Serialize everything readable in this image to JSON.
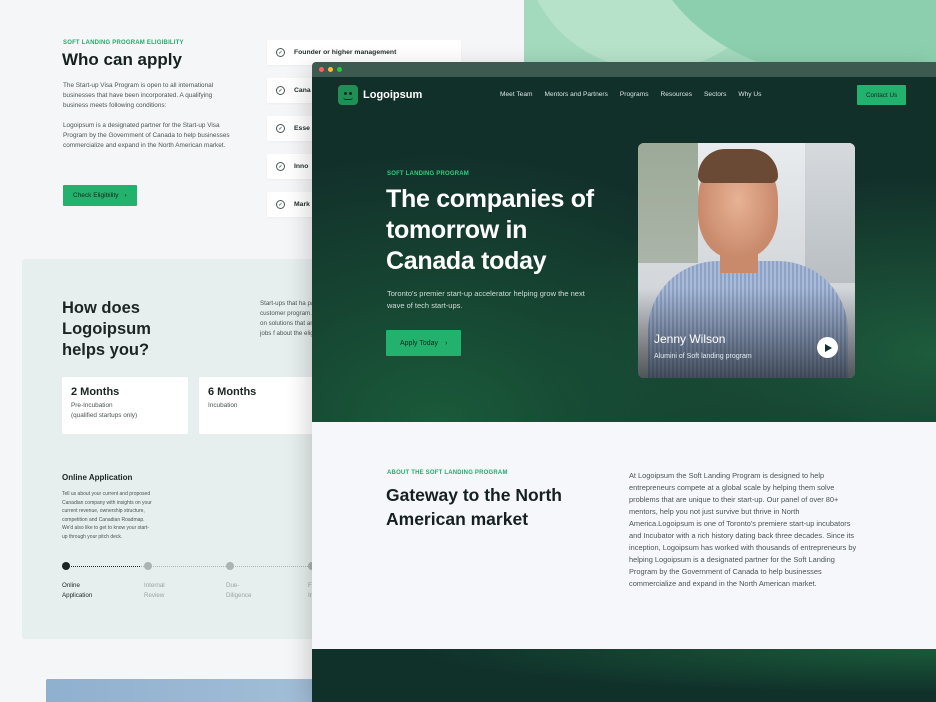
{
  "colors": {
    "accent": "#23b26d",
    "dark": "#12302a",
    "mint": "#a3d9bd"
  },
  "back": {
    "who": {
      "eyebrow": "SOFT LANDING PROGRAM ELIGIBILITY",
      "title": "Who can apply",
      "p1": "The Start-up Visa Program is open to all international businesses that have been incorporated. A qualifying business meets following conditions:",
      "p2": "Logoipsum is a designated partner for the Start-up Visa Program by the Government of Canada to help businesses commercialize and expand in the North American market.",
      "button": "Check Eligibility"
    },
    "criteria": [
      "Founder or higher management",
      "Cana",
      "Esse",
      "Inno",
      "Mark"
    ],
    "how": {
      "title": "How does Logoipsum helps you?",
      "paragraph": "Start-ups that ha paying customer program. We are on solutions that and create jobs f about the eligibil",
      "cards": [
        {
          "title": "2 Months",
          "line1": "Pre-Incubation",
          "line2": "(qualified startups only)"
        },
        {
          "title": "6 Months",
          "line1": "Incubation",
          "line2": ""
        }
      ],
      "online_title": "Online Application",
      "online_text": "Tell us about your current and proposed Canadian company with insights on your current revenue, ownership structure, competition and Canadian Roadmap. We'd also like to get to know your start-up through your pitch deck.",
      "steps": [
        {
          "l1": "Online",
          "l2": "Application"
        },
        {
          "l1": "Internal",
          "l2": "Review"
        },
        {
          "l1": "Due-",
          "l2": "Diligence"
        },
        {
          "l1": "Fi",
          "l2": "In"
        }
      ]
    }
  },
  "front": {
    "logo": "Logoipsum",
    "nav": [
      "Meet Team",
      "Mentors and Partners",
      "Programs",
      "Resources",
      "Sectors",
      "Why Us"
    ],
    "contact": "Contact Us",
    "hero": {
      "eyebrow": "SOFT LANDING PROGRAM",
      "title": "The companies of tomorrow in Canada today",
      "subtitle": "Toronto's premier start-up accelerator helping grow the next wave of tech start-ups.",
      "button": "Apply Today"
    },
    "person": {
      "name": "Jenny Wilson",
      "role": "Alumini of Soft landing program"
    },
    "about": {
      "eyebrow": "ABOUT THE SOFT LANDING PROGRAM",
      "title": "Gateway to the North American market",
      "text": "At Logoipsum the Soft Landing Program is designed to help entrepreneurs compete at a global scale by helping them solve problems that are unique to their start-up. Our panel of over 80+ mentors, help you not just survive but thrive in North America.Logoipsum is one of Toronto's premiere start-up incubators and Incubator with a rich history dating back three decades. Since its inception, Logoipsum has worked with thousands of entrepreneurs by helping Logoipsum is a designated partner for the Soft Landing Program by the Government of Canada to help businesses commercialize and expand in the North American market."
    }
  }
}
